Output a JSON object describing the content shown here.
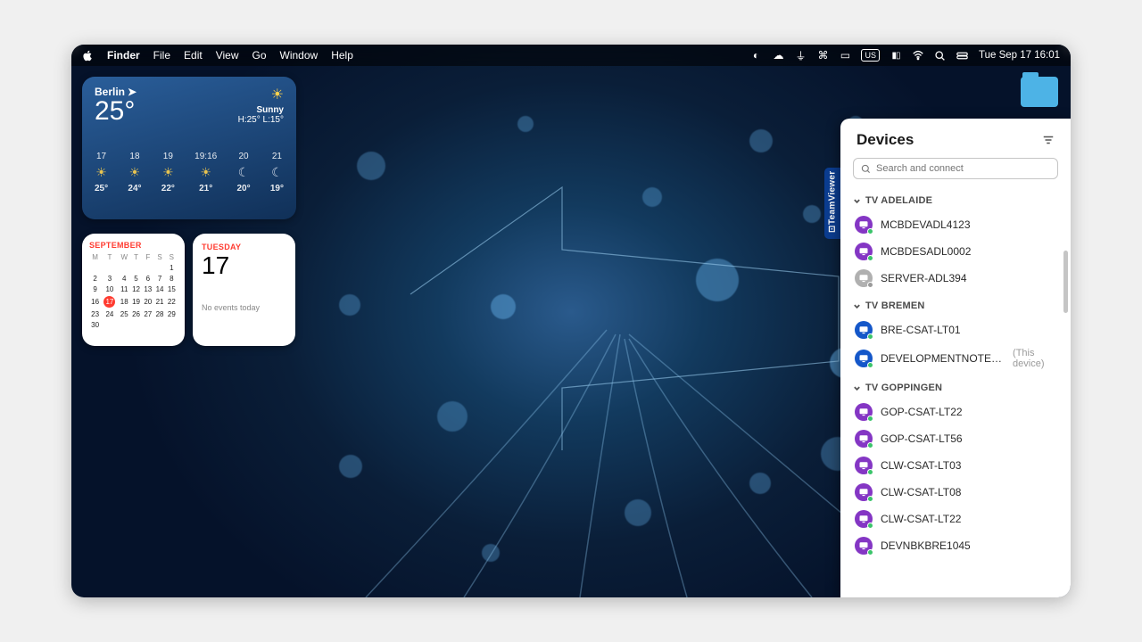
{
  "menubar": {
    "app": "Finder",
    "items": [
      "File",
      "Edit",
      "View",
      "Go",
      "Window",
      "Help"
    ],
    "kbd": "US",
    "clock": "Tue Sep 17  16:01"
  },
  "weather": {
    "location": "Berlin",
    "temp": "25°",
    "condition": "Sunny",
    "hilow": "H:25° L:15°",
    "hours": [
      {
        "time": "17",
        "ico": "sun",
        "temp": "25°"
      },
      {
        "time": "18",
        "ico": "sun",
        "temp": "24°"
      },
      {
        "time": "19",
        "ico": "sun",
        "temp": "22°"
      },
      {
        "time": "19:16",
        "ico": "sunset",
        "temp": "21°"
      },
      {
        "time": "20",
        "ico": "moon",
        "temp": "20°"
      },
      {
        "time": "21",
        "ico": "moon",
        "temp": "19°"
      }
    ]
  },
  "cal": {
    "month": "SEPTEMBER",
    "dow": [
      "M",
      "T",
      "W",
      "T",
      "F",
      "S",
      "S"
    ],
    "weeks": [
      [
        "",
        "",
        "",
        "",
        "",
        "",
        "1"
      ],
      [
        "2",
        "3",
        "4",
        "5",
        "6",
        "7",
        "8"
      ],
      [
        "9",
        "10",
        "11",
        "12",
        "13",
        "14",
        "15"
      ],
      [
        "16",
        "17",
        "18",
        "19",
        "20",
        "21",
        "22"
      ],
      [
        "23",
        "24",
        "25",
        "26",
        "27",
        "28",
        "29"
      ],
      [
        "30",
        "",
        "",
        "",
        "",
        "",
        ""
      ]
    ],
    "today": "17"
  },
  "agenda": {
    "dow": "TUESDAY",
    "day": "17",
    "note": "No events today"
  },
  "tv_tab": "TeamViewer",
  "panel": {
    "title": "Devices",
    "search_placeholder": "Search and connect",
    "groups": [
      {
        "name": "TV ADELAIDE",
        "devices": [
          {
            "name": "MCBDEVADL4123",
            "color": "purple",
            "status": "online"
          },
          {
            "name": "MCBDESADL0002",
            "color": "purple",
            "status": "online"
          },
          {
            "name": "SERVER-ADL394",
            "color": "grey",
            "status": "gear"
          }
        ]
      },
      {
        "name": "TV BREMEN",
        "devices": [
          {
            "name": "BRE-CSAT-LT01",
            "color": "blue",
            "status": "online"
          },
          {
            "name": "DEVELOPMENTNOTE…",
            "color": "blue",
            "status": "online",
            "suffix": "(This device)"
          }
        ]
      },
      {
        "name": "TV GOPPINGEN",
        "devices": [
          {
            "name": "GOP-CSAT-LT22",
            "color": "purple",
            "status": "online"
          },
          {
            "name": "GOP-CSAT-LT56",
            "color": "purple",
            "status": "online"
          },
          {
            "name": "CLW-CSAT-LT03",
            "color": "purple",
            "status": "online"
          },
          {
            "name": "CLW-CSAT-LT08",
            "color": "purple",
            "status": "online"
          },
          {
            "name": "CLW-CSAT-LT22",
            "color": "purple",
            "status": "online"
          },
          {
            "name": "DEVNBKBRE1045",
            "color": "purple",
            "status": "online"
          }
        ]
      }
    ]
  }
}
